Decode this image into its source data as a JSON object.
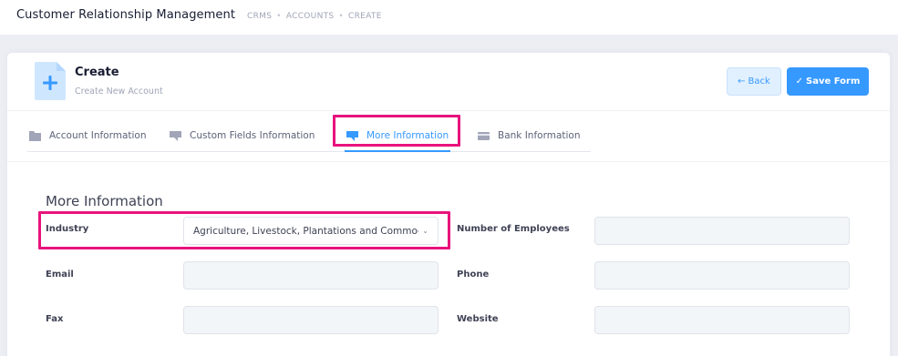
{
  "app": {
    "title": "Customer Relationship Management",
    "breadcrumb": [
      "CRMS",
      "ACCOUNTS",
      "CREATE"
    ]
  },
  "header": {
    "title": "Create",
    "subtitle": "Create New Account",
    "back_label": "Back",
    "save_label": "Save Form",
    "icons": {
      "page": "file-plus-icon",
      "back": "arrow-left-icon",
      "save": "check-icon"
    }
  },
  "tabs": [
    {
      "label": "Account Information",
      "icon": "folder-icon",
      "active": false
    },
    {
      "label": "Custom Fields Information",
      "icon": "chat-icon",
      "active": false
    },
    {
      "label": "More Information",
      "icon": "chat-icon",
      "active": true
    },
    {
      "label": "Bank Information",
      "icon": "card-icon",
      "active": false
    }
  ],
  "section": {
    "title": "More Information"
  },
  "fields": {
    "industry": {
      "label": "Industry",
      "value": "Agriculture, Livestock, Plantations and Commodities"
    },
    "employees": {
      "label": "Number of Employees",
      "value": ""
    },
    "email": {
      "label": "Email",
      "value": ""
    },
    "phone": {
      "label": "Phone",
      "value": ""
    },
    "fax": {
      "label": "Fax",
      "value": ""
    },
    "website": {
      "label": "Website",
      "value": ""
    }
  },
  "colors": {
    "accent": "#3699ff",
    "highlight": "#e8137d",
    "background": "#eceef4"
  }
}
